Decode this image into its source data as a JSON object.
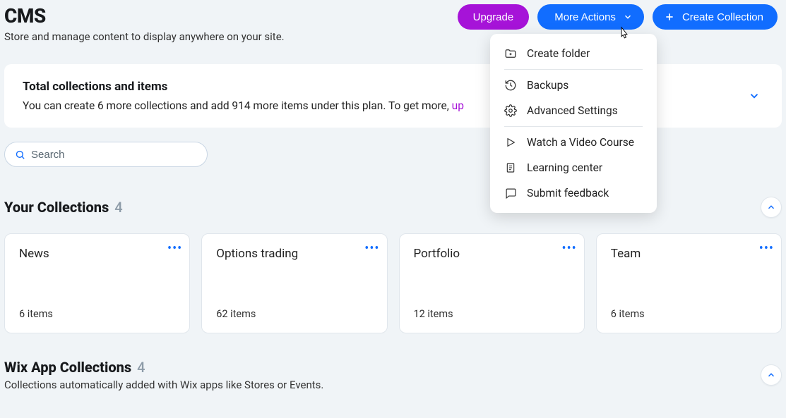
{
  "header": {
    "title": "CMS",
    "subtitle": "Store and manage content to display anywhere on your site.",
    "upgrade_label": "Upgrade",
    "more_actions_label": "More Actions",
    "create_collection_label": "Create Collection"
  },
  "banner": {
    "title": "Total collections and items",
    "text_prefix": "You can create 6 more collections and add 914 more items under this plan. To get more, ",
    "link_text": "up"
  },
  "search": {
    "placeholder": "Search"
  },
  "dropdown": {
    "items": [
      {
        "label": "Create folder"
      },
      {
        "label": "Backups"
      },
      {
        "label": "Advanced Settings"
      },
      {
        "label": "Watch a Video Course"
      },
      {
        "label": "Learning center"
      },
      {
        "label": "Submit feedback"
      }
    ]
  },
  "your_collections": {
    "title": "Your Collections",
    "count": "4",
    "cards": [
      {
        "name": "News",
        "items": "6 items"
      },
      {
        "name": "Options trading",
        "items": "62 items"
      },
      {
        "name": "Portfolio",
        "items": "12 items"
      },
      {
        "name": "Team",
        "items": "6 items"
      }
    ]
  },
  "wix_collections": {
    "title": "Wix App Collections",
    "count": "4",
    "subtitle": "Collections automatically added with Wix apps like Stores or Events."
  }
}
